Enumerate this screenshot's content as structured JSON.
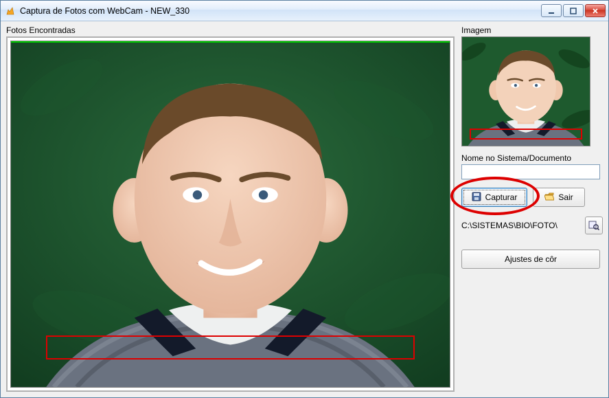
{
  "window": {
    "title": "Captura de Fotos com WebCam - NEW_330"
  },
  "left": {
    "label": "Fotos Encontradas"
  },
  "right": {
    "image_label": "Imagem",
    "name_label": "Nome no Sistema/Documento",
    "name_value": "",
    "capture_btn": "Capturar",
    "exit_btn": "Sair",
    "path": "C:\\SISTEMAS\\BIO\\FOTO\\",
    "adjust_btn": "Ajustes de côr"
  }
}
